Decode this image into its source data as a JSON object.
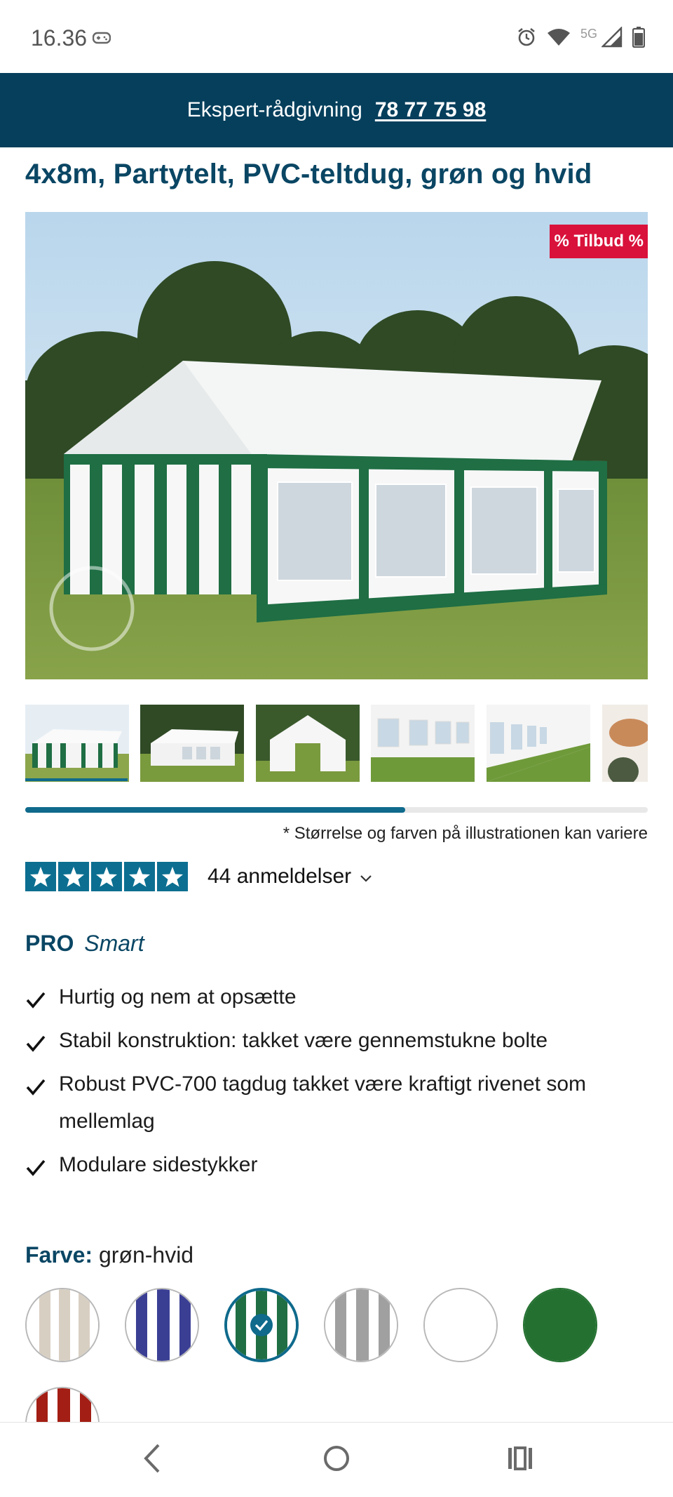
{
  "status_bar": {
    "time": "16.36",
    "network": "5G",
    "icons": [
      "game-controller-icon",
      "alarm-icon",
      "wifi-icon",
      "signal-icon",
      "battery-icon"
    ]
  },
  "banner": {
    "label": "Ekspert-rådgivning",
    "phone": "78 77 75 98",
    "background": "#053f5c"
  },
  "product": {
    "title": "4x8m, Partytelt, PVC-teltdug, grøn og hvid",
    "badge": "% Tilbud %",
    "badge_color": "#d9123b",
    "thumbnail_count": 6,
    "active_thumbnail": 1,
    "scroll_progress": 0.61,
    "disclaimer": "* Størrelse og farven på illustrationen kan variere"
  },
  "rating": {
    "stars": 5,
    "reviews": "44 anmeldelser",
    "accent": "#0c6f91"
  },
  "line": {
    "brand": "PRO",
    "variant": "Smart"
  },
  "features": [
    "Hurtig og nem at opsætte",
    "Stabil konstruktion: takket være gennemstukne bolte",
    "Robust PVC-700 tagdug takket være kraftigt rivenet som mellemlag",
    "Modulare sidestykker"
  ],
  "color": {
    "label": "Farve:",
    "value": "grøn-hvid",
    "swatches": [
      {
        "name": "beige-hvid",
        "colors": [
          "#d8cfc3",
          "#ffffff"
        ]
      },
      {
        "name": "blå-hvid",
        "colors": [
          "#3b3f94",
          "#ffffff"
        ]
      },
      {
        "name": "grøn-hvid",
        "colors": [
          "#1f6e44",
          "#ffffff"
        ],
        "selected": true
      },
      {
        "name": "grå-hvid",
        "colors": [
          "#a0a0a0",
          "#ffffff"
        ]
      },
      {
        "name": "hvid",
        "colors": [
          "#ffffff",
          "#ffffff"
        ]
      },
      {
        "name": "grøn",
        "colors": [
          "#237030",
          "#237030"
        ]
      },
      {
        "name": "rød-hvid",
        "colors": [
          "#a31e14",
          "#ffffff"
        ]
      }
    ]
  },
  "nav": {
    "icons": [
      "back-icon",
      "home-icon",
      "recents-icon"
    ]
  }
}
